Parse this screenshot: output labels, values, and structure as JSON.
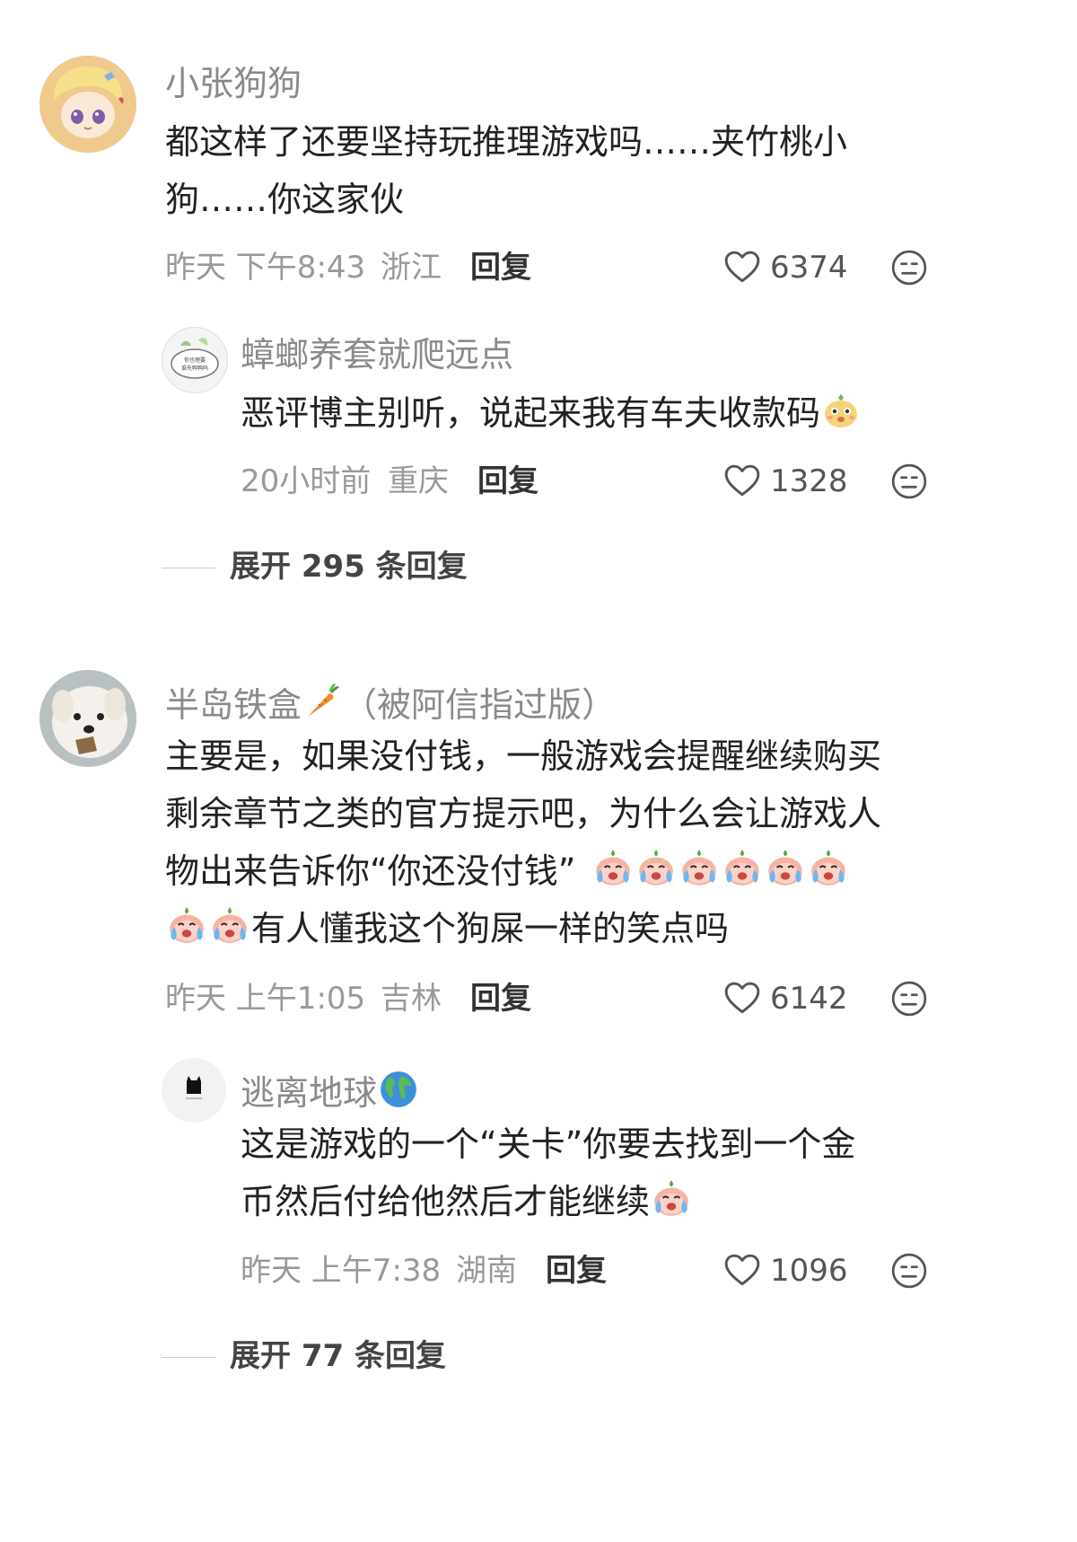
{
  "comments": [
    {
      "username": "小张狗狗",
      "content": "都这样了还要坚持玩推理游戏吗……夹竹桃小狗……你这家伙",
      "time": "昨天 下午8:43",
      "location": "浙江",
      "reply_label": "回复",
      "likes": "6374",
      "replies": [
        {
          "username": "蟑螂养套就爬远点",
          "avatar_text": "你也理要 谁先鸭鸭吗",
          "content": "恶评博主别听，说起来我有车夫收款码",
          "time": "20小时前",
          "location": "重庆",
          "reply_label": "回复",
          "likes": "1328"
        }
      ],
      "expand_label": "展开 295 条回复"
    },
    {
      "username": "半岛铁盒",
      "username_suffix": "（被阿信指过版）",
      "content_lines": [
        "主要是，如果没付钱，一般游戏会提醒继续购买",
        "剩余章节之类的官方提示吧，为什么会让游戏人",
        "物出来告诉你“你还没付钱”",
        "有人懂我这个狗屎一样的笑点吗"
      ],
      "time": "昨天 上午1:05",
      "location": "吉林",
      "reply_label": "回复",
      "likes": "6142",
      "replies": [
        {
          "username": "逃离地球",
          "content_lines": [
            "这是游戏的一个“关卡”你要去找到一个金",
            "币然后付给他然后才能继续"
          ],
          "time": "昨天 上午7:38",
          "location": "湖南",
          "reply_label": "回复",
          "likes": "1096"
        }
      ],
      "expand_label": "展开 77 条回复"
    }
  ],
  "icons": {
    "like": "heart-outline-icon",
    "dislike": "neutral-face-icon",
    "emoji_bun": "bun-face-emoji",
    "emoji_cry": "crying-peach-emoji",
    "emoji_carrot": "carrot-emoji",
    "emoji_globe": "globe-emoji"
  },
  "colors": {
    "username": "#8a8a8a",
    "content": "#222222",
    "meta": "#999999",
    "reply": "#333333"
  }
}
